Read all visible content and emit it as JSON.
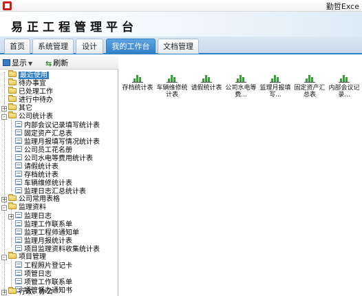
{
  "window": {
    "title": "勤哲Exce"
  },
  "app": {
    "brand": "易正工程管理平台"
  },
  "tabs": [
    {
      "label": "首页"
    },
    {
      "label": "系统管理"
    },
    {
      "label": "设计"
    },
    {
      "label": "我的工作台",
      "active": true
    },
    {
      "label": "文档管理"
    }
  ],
  "toolbar": {
    "show_label": "显示",
    "refresh_label": "刷新"
  },
  "tree": [
    {
      "label": "最近使用",
      "level": 0,
      "icon": "folder-icon",
      "selected": true
    },
    {
      "label": "待办事宜",
      "level": 0,
      "icon": "folder-icon"
    },
    {
      "label": "已处理工作",
      "level": 0,
      "icon": "folder-icon"
    },
    {
      "label": "进行中待办",
      "level": 0,
      "icon": "folder-icon"
    },
    {
      "label": "其它",
      "level": 0,
      "icon": "folder-icon",
      "expander": "+"
    },
    {
      "label": "公司统计表",
      "level": 0,
      "icon": "folder-icon",
      "expander": "-"
    },
    {
      "label": "内部会议记录填写统计表",
      "level": 1,
      "icon": "doc-icon"
    },
    {
      "label": "固定资产汇总表",
      "level": 1,
      "icon": "doc-icon"
    },
    {
      "label": "监理月报填写情况统计表",
      "level": 1,
      "icon": "doc-icon"
    },
    {
      "label": "公司员工花名册",
      "level": 1,
      "icon": "doc-icon"
    },
    {
      "label": "公司水电等费用统计表",
      "level": 1,
      "icon": "doc-icon"
    },
    {
      "label": "请假统计表",
      "level": 1,
      "icon": "doc-icon"
    },
    {
      "label": "存档统计表",
      "level": 1,
      "icon": "doc-icon"
    },
    {
      "label": "车辆维修统计表",
      "level": 1,
      "icon": "doc-icon"
    },
    {
      "label": "监理日志汇总统计表",
      "level": 1,
      "icon": "doc-icon"
    },
    {
      "label": "公司常用表格",
      "level": 0,
      "icon": "folder-icon",
      "expander": "+"
    },
    {
      "label": "监理资料",
      "level": 0,
      "icon": "folder-icon",
      "expander": "-"
    },
    {
      "label": "监理日志",
      "level": 1,
      "icon": "doc-icon",
      "expander": "+"
    },
    {
      "label": "监理工作联系单",
      "level": 1,
      "icon": "doc-icon"
    },
    {
      "label": "监理工程师通知单",
      "level": 1,
      "icon": "doc-icon"
    },
    {
      "label": "监理月报统计表",
      "level": 1,
      "icon": "doc-icon"
    },
    {
      "label": "项目监理资料收集统计表",
      "level": 1,
      "icon": "doc-icon"
    },
    {
      "label": "项目管理",
      "level": 0,
      "icon": "folder-icon",
      "expander": "-"
    },
    {
      "label": "工程照片登记卡",
      "level": 1,
      "icon": "doc-icon"
    },
    {
      "label": "项管日志",
      "level": 1,
      "icon": "doc-icon"
    },
    {
      "label": "项管工作联系单",
      "level": 1,
      "icon": "doc-icon"
    },
    {
      "label": "项管督办通知书",
      "level": 1,
      "icon": "doc-icon"
    },
    {
      "label": "行政、办公",
      "level": 0,
      "icon": "folder-icon",
      "expander": "+"
    }
  ],
  "reports": [
    {
      "label": "存档统计表"
    },
    {
      "label": "车辆维修统计表"
    },
    {
      "label": "请假统计表"
    },
    {
      "label": "公司水电等费..."
    },
    {
      "label": "监理月报填写..."
    },
    {
      "label": "固定资产汇总表"
    },
    {
      "label": "内部会议记录..."
    }
  ],
  "colors": {
    "accent": "#2f7ec4",
    "chart_icon": "#3d9c3d"
  }
}
